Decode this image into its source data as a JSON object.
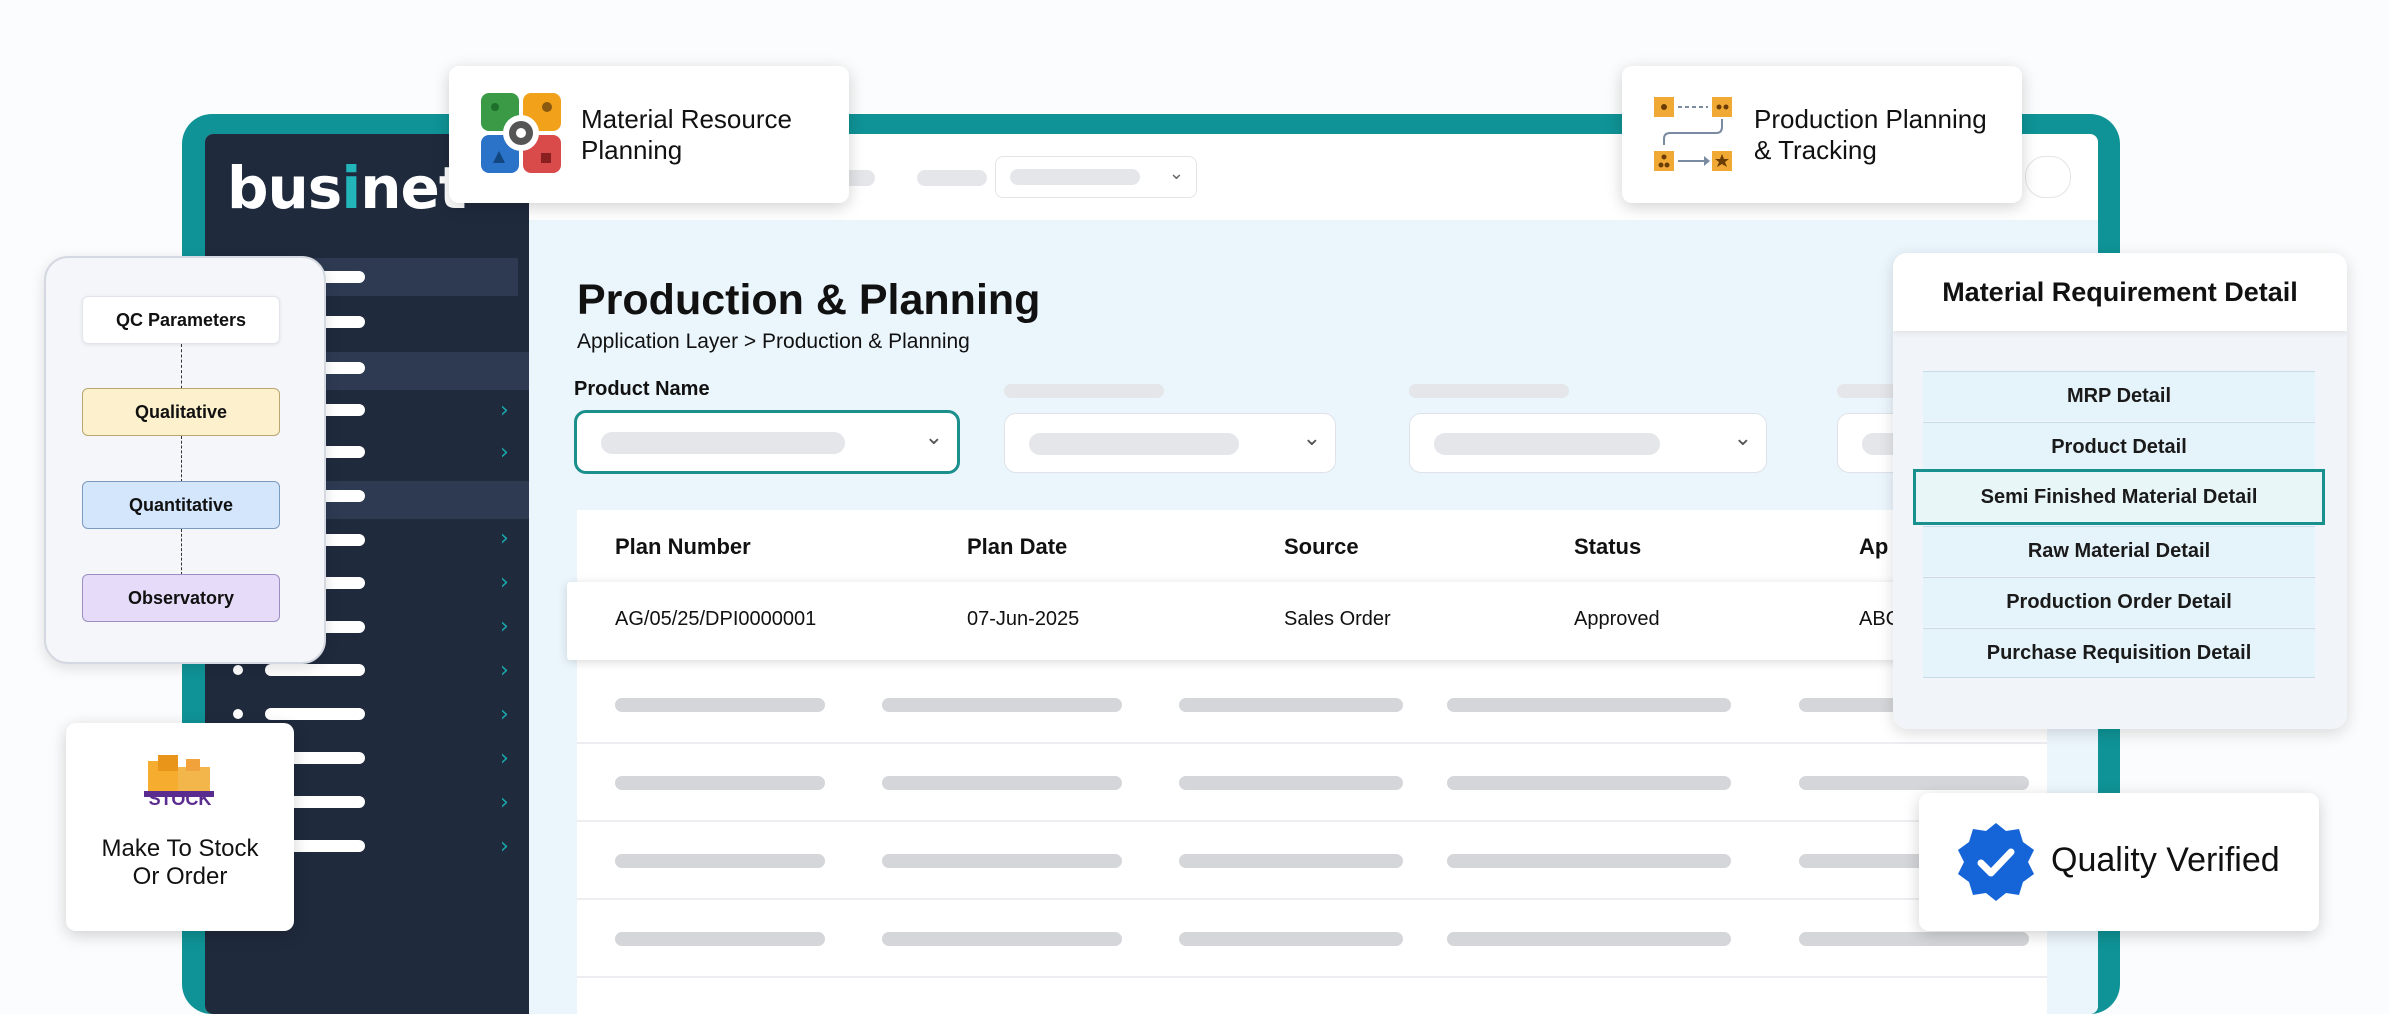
{
  "brand": {
    "logo_text_a": "bus",
    "logo_text_i": "i",
    "logo_text_b": "net"
  },
  "page": {
    "title": "Production & Planning",
    "breadcrumb": "Application Layer > Production & Planning",
    "product_name_label": "Product Name"
  },
  "table": {
    "headers": [
      "Plan Number",
      "Plan Date",
      "Source",
      "Status",
      "Ap"
    ],
    "row": [
      "AG/05/25/DPI0000001",
      "07-Jun-2025",
      "Sales Order",
      "Approved",
      "ABC"
    ]
  },
  "badges": {
    "mrp": "Material Resource Planning",
    "ppt": "Production Planning & Tracking",
    "quality": "Quality Verified",
    "stock_label": "STOCK",
    "mto": "Make To Stock Or Order"
  },
  "qc": {
    "title": "QC Parameters",
    "steps": [
      "Qualitative",
      "Quantitative",
      "Observatory"
    ]
  },
  "mrd": {
    "title": "Material Requirement Detail",
    "items": [
      "MRP Detail",
      "Product Detail",
      "Semi Finished Material Detail",
      "Raw Material Detail",
      "Production Order Detail",
      "Purchase Requisition Detail"
    ],
    "selected_index": 2
  },
  "colors": {
    "teal": "#0f9396",
    "sidebar": "#1f2a3d",
    "accent_blue": "#1565d8"
  }
}
